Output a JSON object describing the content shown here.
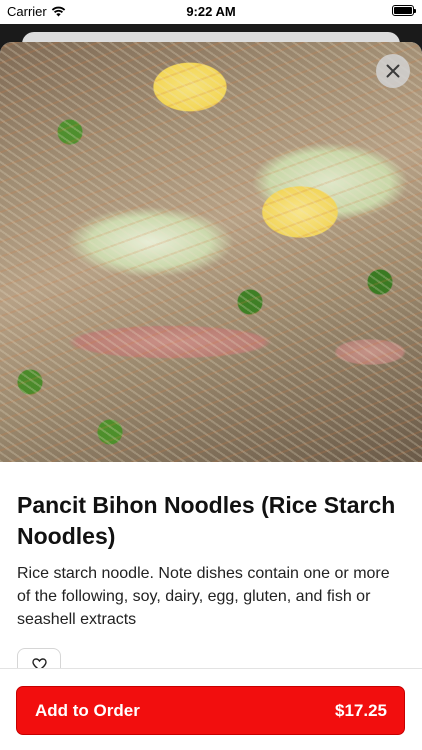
{
  "status_bar": {
    "carrier": "Carrier",
    "time": "9:22 AM"
  },
  "item": {
    "name": "Pancit Bihon Noodles (Rice Starch Noodles)",
    "description": "Rice starch noodle. Note dishes contain one or more of the following, soy, dairy, egg, gluten, and fish or seashell extracts"
  },
  "actions": {
    "add_label": "Add to Order",
    "price": "$17.25"
  },
  "colors": {
    "accent": "#f20e0e"
  },
  "icons": {
    "close": "close-icon",
    "favorite": "heart-icon",
    "wifi": "wifi-icon",
    "battery": "battery-icon"
  }
}
